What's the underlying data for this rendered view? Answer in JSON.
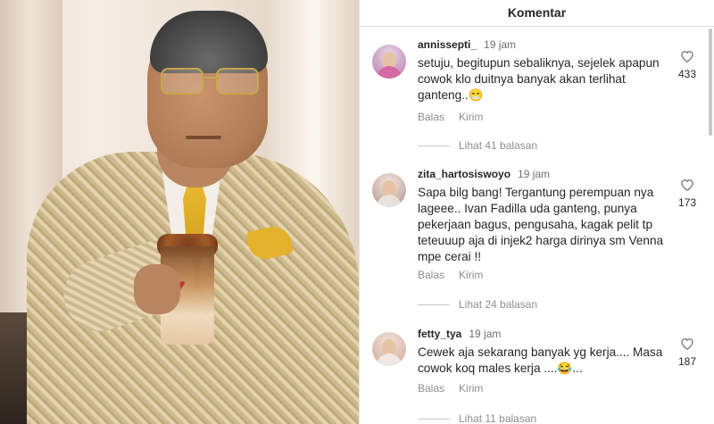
{
  "header": {
    "title": "Komentar"
  },
  "comments": [
    {
      "username": "annissepti_",
      "time": "19 jam",
      "text": "setuju, begitupun sebaliknya, sejelek apapun cowok klo duitnya banyak akan terlihat ganteng..😁",
      "likes": "433",
      "reply_label": "Balas",
      "send_label": "Kirim",
      "view_replies": "Lihat 41 balasan"
    },
    {
      "username": "zita_hartosiswoyo",
      "time": "19 jam",
      "text": "Sapa bilg bang! Tergantung perempuan nya lageee.. Ivan Fadilla uda ganteng, punya pekerjaan bagus, pengusaha, kagak pelit tp teteuuup aja di injek2 harga dirinya sm Venna mpe cerai !!",
      "likes": "173",
      "reply_label": "Balas",
      "send_label": "Kirim",
      "view_replies": "Lihat 24 balasan"
    },
    {
      "username": "fetty_tya",
      "time": "19 jam",
      "text": "Cewek aja sekarang banyak yg kerja.... Masa cowok koq males kerja ....😂...",
      "likes": "187",
      "reply_label": "Balas",
      "send_label": "Kirim",
      "view_replies": "Lihat 11 balasan"
    }
  ],
  "icons": {
    "like": "heart-outline-icon"
  },
  "colors": {
    "text": "#262626",
    "muted": "#8e8e8e",
    "divider": "#dcdcdc"
  }
}
